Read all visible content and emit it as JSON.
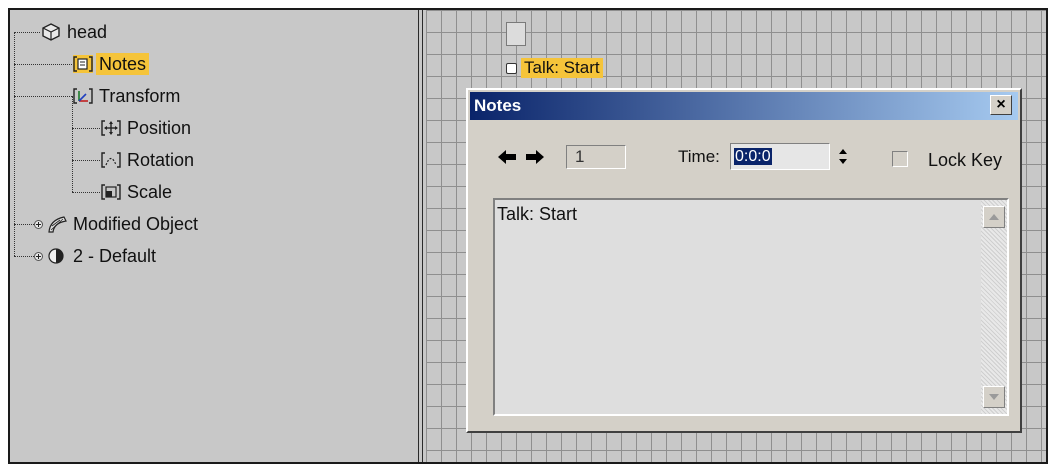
{
  "tree": {
    "items": [
      {
        "label": "head",
        "icon": "object-icon"
      },
      {
        "label": "Notes",
        "icon": "notes-icon",
        "selected": true
      },
      {
        "label": "Transform",
        "icon": "transform-icon"
      },
      {
        "label": "Position",
        "icon": "position-icon"
      },
      {
        "label": "Rotation",
        "icon": "rotation-icon"
      },
      {
        "label": "Scale",
        "icon": "scale-icon"
      },
      {
        "label": "Modified Object",
        "icon": "modifier-icon"
      },
      {
        "label": "2 - Default",
        "icon": "material-icon"
      }
    ]
  },
  "track": {
    "key_label": "Talk: Start"
  },
  "dialog": {
    "title": "Notes",
    "close_label": "×",
    "key_number": "1",
    "time_label": "Time:",
    "time_value": "0:0:0",
    "lock_key_label": "Lock Key",
    "lock_key_checked": false,
    "notes_text": "Talk: Start"
  },
  "colors": {
    "selection": "#f5c43a",
    "titlebar_start": "#0a246a",
    "titlebar_end": "#a6caf0",
    "panel": "#c8c8c8"
  }
}
